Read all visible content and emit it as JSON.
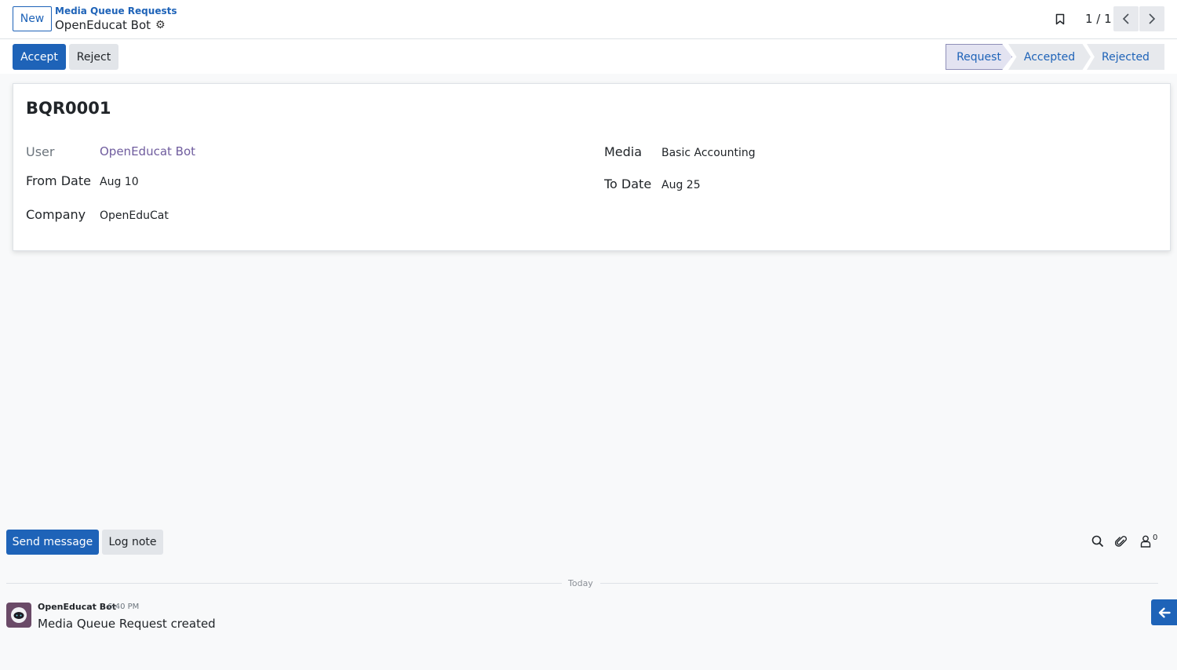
{
  "control_panel": {
    "new_label": "New",
    "breadcrumb": "Media Queue Requests",
    "record_name": "OpenEducat Bot",
    "pager": "1 / 1"
  },
  "actions": {
    "accept_label": "Accept",
    "reject_label": "Reject"
  },
  "statusbar": {
    "steps": [
      "Request",
      "Accepted",
      "Rejected"
    ],
    "active": "Request"
  },
  "form": {
    "reference": "BQR0001",
    "fields": {
      "user": {
        "label": "User",
        "value": "OpenEducat Bot"
      },
      "from_date": {
        "label": "From Date",
        "value": "Aug 10"
      },
      "company": {
        "label": "Company",
        "value": "OpenEduCat"
      },
      "media": {
        "label": "Media",
        "value": "Basic Accounting"
      },
      "to_date": {
        "label": "To Date",
        "value": "Aug 25"
      }
    }
  },
  "chatter": {
    "send_message_label": "Send message",
    "log_note_label": "Log note",
    "follower_count": "0",
    "date_separator": "Today",
    "messages": [
      {
        "author": "OpenEducat Bot",
        "time": "6:40 PM",
        "body": "Media Queue Request created"
      }
    ]
  },
  "icons": [
    "gear-icon",
    "bookmark-icon",
    "chevron-left-icon",
    "chevron-right-icon",
    "search-icon",
    "paperclip-icon",
    "follower-icon",
    "arrow-left-icon"
  ],
  "colors": {
    "primary": "#1e63b8",
    "link": "#6f5c9e",
    "avatar": "#6a4a67"
  }
}
